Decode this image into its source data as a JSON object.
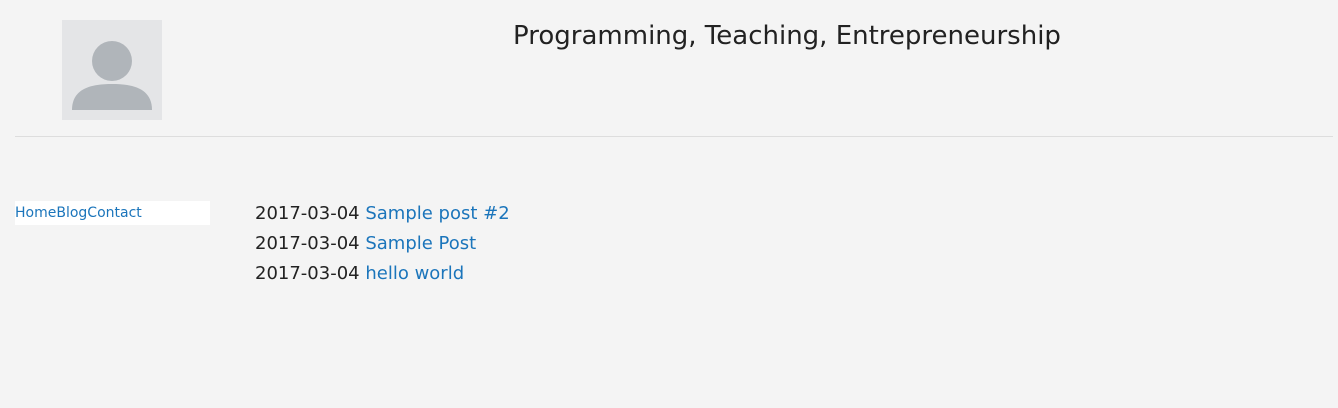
{
  "header": {
    "avatar_icon": "user-silhouette-icon",
    "title": "Programming, Teaching, Entrepreneurship"
  },
  "nav": {
    "items": [
      {
        "label": "Home"
      },
      {
        "label": "Blog"
      },
      {
        "label": "Contact"
      }
    ]
  },
  "posts": [
    {
      "date": "2017-03-04",
      "title": "Sample post #2"
    },
    {
      "date": "2017-03-04",
      "title": "Sample Post"
    },
    {
      "date": "2017-03-04",
      "title": "hello world"
    }
  ],
  "colors": {
    "background": "#f4f4f4",
    "link": "#1b75bb",
    "text": "#222222",
    "avatar_bg": "#e4e5e7",
    "avatar_fg": "#b0b5ba",
    "divider": "#dddddd"
  }
}
